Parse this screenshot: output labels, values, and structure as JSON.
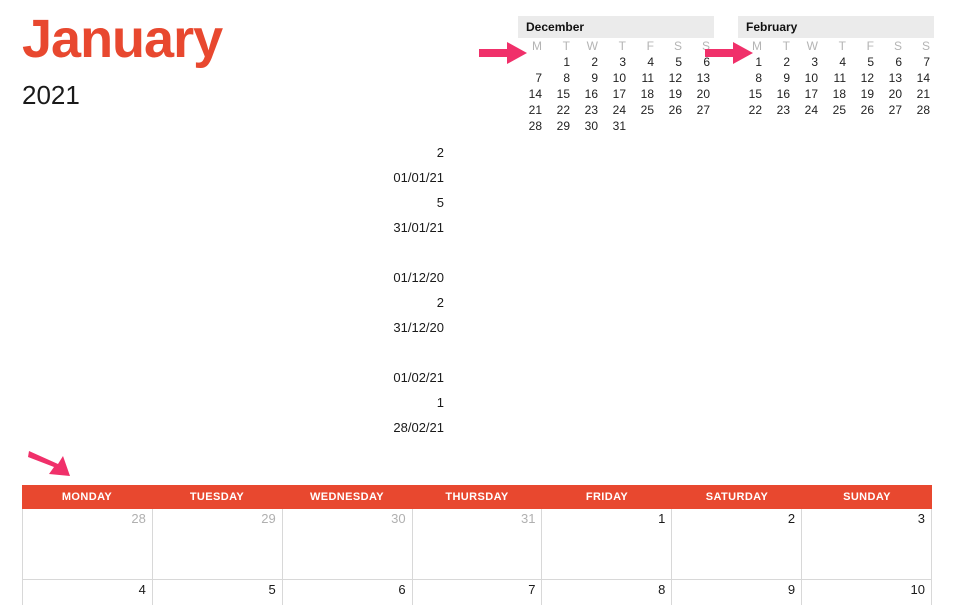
{
  "title": {
    "month": "January",
    "year": "2021",
    "accent_color": "#e8482f"
  },
  "mini_calendars": [
    {
      "name": "prev-month",
      "label": "December",
      "weekdays": [
        "M",
        "T",
        "W",
        "T",
        "F",
        "S",
        "S"
      ],
      "weeks": [
        [
          "",
          "1",
          "2",
          "3",
          "4",
          "5",
          "6"
        ],
        [
          "7",
          "8",
          "9",
          "10",
          "11",
          "12",
          "13"
        ],
        [
          "14",
          "15",
          "16",
          "17",
          "18",
          "19",
          "20"
        ],
        [
          "21",
          "22",
          "23",
          "24",
          "25",
          "26",
          "27"
        ],
        [
          "28",
          "29",
          "30",
          "31",
          "",
          "",
          ""
        ]
      ]
    },
    {
      "name": "next-month",
      "label": "February",
      "weekdays": [
        "M",
        "T",
        "W",
        "T",
        "F",
        "S",
        "S"
      ],
      "weeks": [
        [
          "1",
          "2",
          "3",
          "4",
          "5",
          "6",
          "7"
        ],
        [
          "8",
          "9",
          "10",
          "11",
          "12",
          "13",
          "14"
        ],
        [
          "15",
          "16",
          "17",
          "18",
          "19",
          "20",
          "21"
        ],
        [
          "22",
          "23",
          "24",
          "25",
          "26",
          "27",
          "28"
        ],
        [
          "",
          "",
          "",
          "",
          "",
          "",
          ""
        ]
      ]
    }
  ],
  "value_column": [
    {
      "type": "value",
      "text": "2"
    },
    {
      "type": "value",
      "text": "01/01/21"
    },
    {
      "type": "value",
      "text": "5"
    },
    {
      "type": "value",
      "text": "31/01/21"
    },
    {
      "type": "gap",
      "text": ""
    },
    {
      "type": "value",
      "text": "01/12/20"
    },
    {
      "type": "value",
      "text": "2"
    },
    {
      "type": "value",
      "text": "31/12/20"
    },
    {
      "type": "gap",
      "text": ""
    },
    {
      "type": "value",
      "text": "01/02/21"
    },
    {
      "type": "value",
      "text": "1"
    },
    {
      "type": "value",
      "text": "28/02/21"
    }
  ],
  "arrows": [
    {
      "name": "arrow-prev-month",
      "direction": "right",
      "color": "#f0306a"
    },
    {
      "name": "arrow-next-month",
      "direction": "right",
      "color": "#f0306a"
    },
    {
      "name": "arrow-weekday-header",
      "direction": "down-right",
      "color": "#f0306a"
    }
  ],
  "calendar": {
    "weekdays": [
      "MONDAY",
      "TUESDAY",
      "WEDNESDAY",
      "THURSDAY",
      "FRIDAY",
      "SATURDAY",
      "SUNDAY"
    ],
    "header_color": "#e8482f",
    "rows": [
      {
        "cells": [
          {
            "text": "28",
            "muted": true
          },
          {
            "text": "29",
            "muted": true
          },
          {
            "text": "30",
            "muted": true
          },
          {
            "text": "31",
            "muted": true
          },
          {
            "text": "1",
            "muted": false
          },
          {
            "text": "2",
            "muted": false
          },
          {
            "text": "3",
            "muted": false
          }
        ]
      },
      {
        "cells": [
          {
            "text": "4",
            "muted": false
          },
          {
            "text": "5",
            "muted": false
          },
          {
            "text": "6",
            "muted": false
          },
          {
            "text": "7",
            "muted": false
          },
          {
            "text": "8",
            "muted": false
          },
          {
            "text": "9",
            "muted": false
          },
          {
            "text": "10",
            "muted": false
          }
        ]
      }
    ]
  }
}
